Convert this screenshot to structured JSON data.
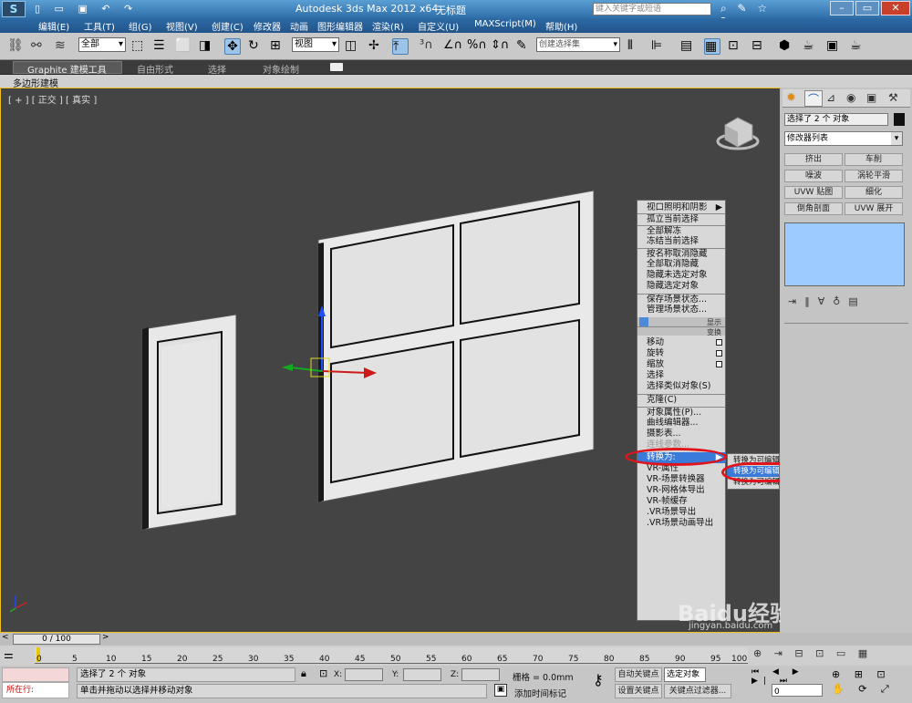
{
  "app": {
    "title": "Autodesk 3ds Max  2012 x64",
    "document": "无标题",
    "search_placeholder": "键入关键字或短语"
  },
  "menu": [
    "编辑(E)",
    "工具(T)",
    "组(G)",
    "视图(V)",
    "创建(C)",
    "修改器",
    "动画",
    "图形编辑器",
    "渲染(R)",
    "自定义(U)",
    "MAXScript(M)",
    "帮助(H)"
  ],
  "toolbar": {
    "selection_filter": "全部",
    "ref_coord": "视图",
    "named_selection": "创建选择集"
  },
  "ribbon": {
    "tabs": [
      "Graphite 建模工具",
      "自由形式",
      "选择",
      "对象绘制"
    ],
    "sub": "多边形建模"
  },
  "viewport": {
    "label": "[ + ] [ 正交 ] [ 真实 ]"
  },
  "quad_menu": {
    "items": [
      "视口照明和阴影",
      "孤立当前选择",
      "全部解冻",
      "冻结当前选择",
      "按名称取消隐藏",
      "全部取消隐藏",
      "隐藏未选定对象",
      "隐藏选定对象",
      "保存场景状态...",
      "管理场景状态...",
      "",
      "",
      "移动",
      "旋转",
      "缩放",
      "选择",
      "选择类似对象(S)",
      "克隆(C)",
      "对象属性(P)...",
      "曲线编辑器...",
      "摄影表...",
      "连线参数...",
      "转换为:",
      "VR-属性",
      "VR-场景转换器",
      "VR-网格体导出",
      "VR-帧缓存",
      ".VR场景导出",
      ".VR场景动画导出"
    ],
    "labels_right": [
      "显示",
      "变换"
    ],
    "submenu": [
      "转换为可编辑网格",
      "转换为可编辑多边形",
      "转换为可编辑面片"
    ]
  },
  "command_panel": {
    "selected": "选择了 2 个 对象",
    "modifier_list": "修改器列表",
    "buttons": [
      "挤出",
      "车削",
      "噪波",
      "涡轮平滑",
      "UVW 贴图",
      "细化",
      "倒角剖面",
      "UVW 展开"
    ]
  },
  "timeline": {
    "frame": "0 / 100",
    "ticks": [
      "0",
      "5",
      "10",
      "15",
      "20",
      "25",
      "30",
      "35",
      "40",
      "45",
      "50",
      "55",
      "60",
      "65",
      "70",
      "75",
      "80",
      "85",
      "90",
      "95",
      "100"
    ]
  },
  "status": {
    "row_label": "所在行:",
    "selected": "选择了 2 个 对象",
    "prompt": "单击并拖动以选择并移动对象",
    "x": "X:",
    "y": "Y:",
    "z": "Z:",
    "grid": "栅格 = 0.0mm",
    "auto_key": "自动关键点",
    "selected_obj": "选定对象",
    "set_key": "设置关键点",
    "key_filters": "关键点过滤器...",
    "add_time_tag": "添加时间标记",
    "frame_value": "0"
  },
  "watermark": "Baidu经验",
  "watermark_url": "jingyan.baidu.com"
}
